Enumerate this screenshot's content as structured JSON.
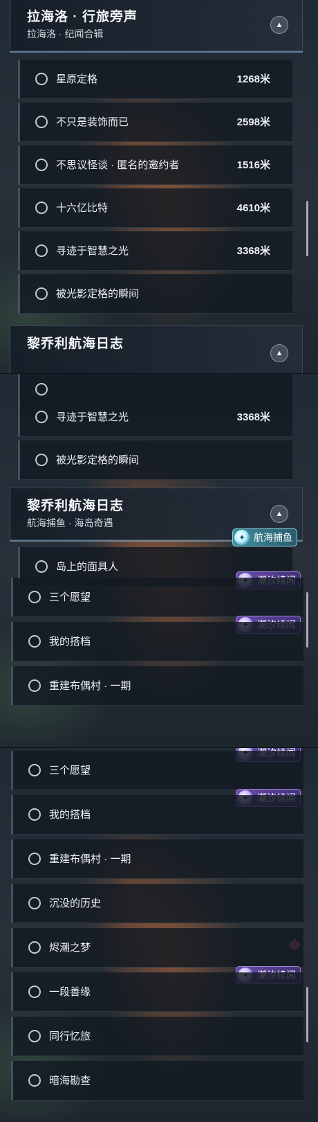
{
  "frame1": {
    "header": {
      "title": "拉海洛 · 行旅旁声",
      "subtitle": "拉海洛 · 纪闻合辑",
      "collapse_icon": "▲"
    },
    "rows": [
      {
        "label": "星原定格",
        "distance": "1268米"
      },
      {
        "label": "不只是装饰而已",
        "distance": "2598米"
      },
      {
        "label": "不思议怪谈 · 匿名的邀约者",
        "distance": "1516米"
      },
      {
        "label": "十六亿比特",
        "distance": "4610米"
      },
      {
        "label": "寻迹于智慧之光",
        "distance": "3368米"
      },
      {
        "label": "被光影定格的瞬间",
        "distance": ""
      }
    ],
    "next_header": {
      "title": "黎乔利航海日志"
    }
  },
  "frame2": {
    "rows": [
      {
        "label": "寻迹于智慧之光",
        "distance": "3368米"
      },
      {
        "label": "被光影定格的瞬间",
        "distance": ""
      }
    ],
    "header": {
      "title": "黎乔利航海日志",
      "subtitle": "航海捕鱼 · 海岛奇遇",
      "collapse_icon": "▲"
    },
    "quests": [
      {
        "label": "岛上的面具人",
        "badge": "航海捕鱼"
      },
      {
        "label": "三个愿望",
        "badge": "潮汐续闻"
      },
      {
        "label": "我的搭档",
        "badge": "潮汐续闻"
      },
      {
        "label": "重建布偶村 · 一期",
        "badge": ""
      }
    ]
  },
  "frame3": {
    "quests": [
      {
        "label": "三个愿望",
        "badge": "潮汐续闻"
      },
      {
        "label": "我的搭档",
        "badge": "潮汐续闻"
      },
      {
        "label": "重建布偶村 · 一期",
        "badge": ""
      },
      {
        "label": "沉没的历史",
        "badge": ""
      },
      {
        "label": "烬潮之梦",
        "badge": ""
      },
      {
        "label": "一段善缘",
        "badge": "潮汐续闻"
      },
      {
        "label": "同行忆旅",
        "badge": ""
      },
      {
        "label": "暗海勘查",
        "badge": ""
      }
    ]
  },
  "icons": {
    "tide_badge": "tide-swirl-icon",
    "fishing_badge": "fishing-swirl-icon",
    "marker": "red-diamond-marker-icon"
  },
  "colors": {
    "badge_purple": "#6a4ba8",
    "badge_teal": "#3f8ea0",
    "marker_red": "#d8485a"
  }
}
